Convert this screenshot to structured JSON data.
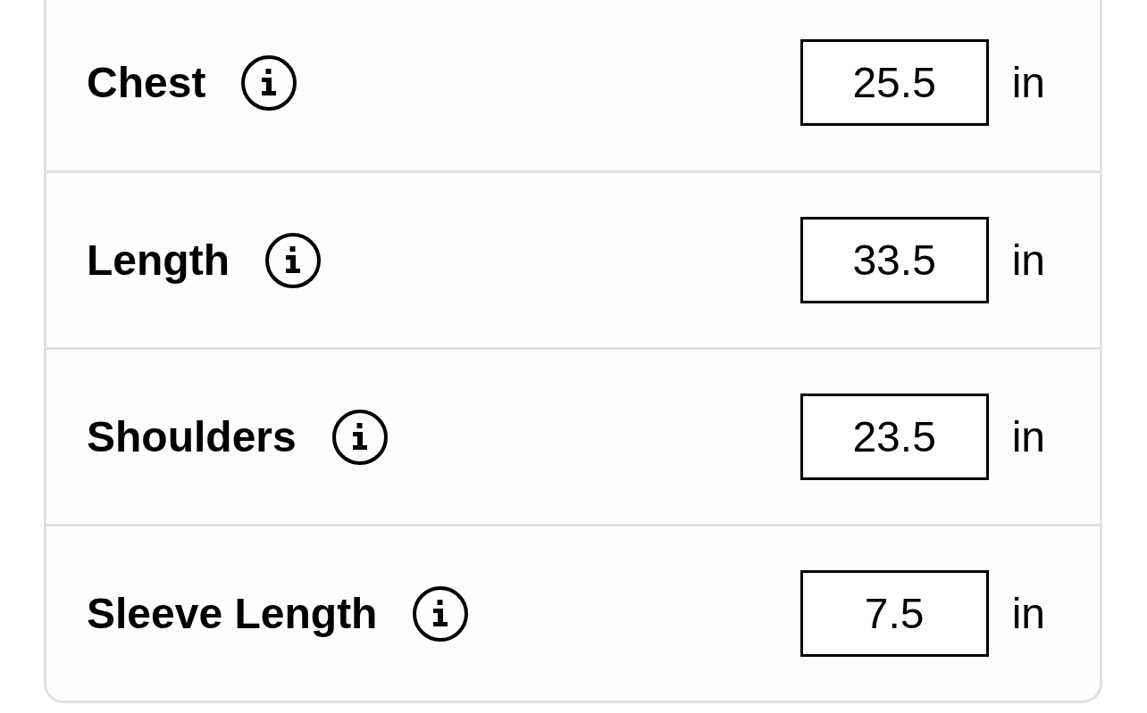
{
  "measurements": [
    {
      "label": "Chest",
      "value": "25.5",
      "unit": "in"
    },
    {
      "label": "Length",
      "value": "33.5",
      "unit": "in"
    },
    {
      "label": "Shoulders",
      "value": "23.5",
      "unit": "in"
    },
    {
      "label": "Sleeve Length",
      "value": "7.5",
      "unit": "in"
    }
  ]
}
